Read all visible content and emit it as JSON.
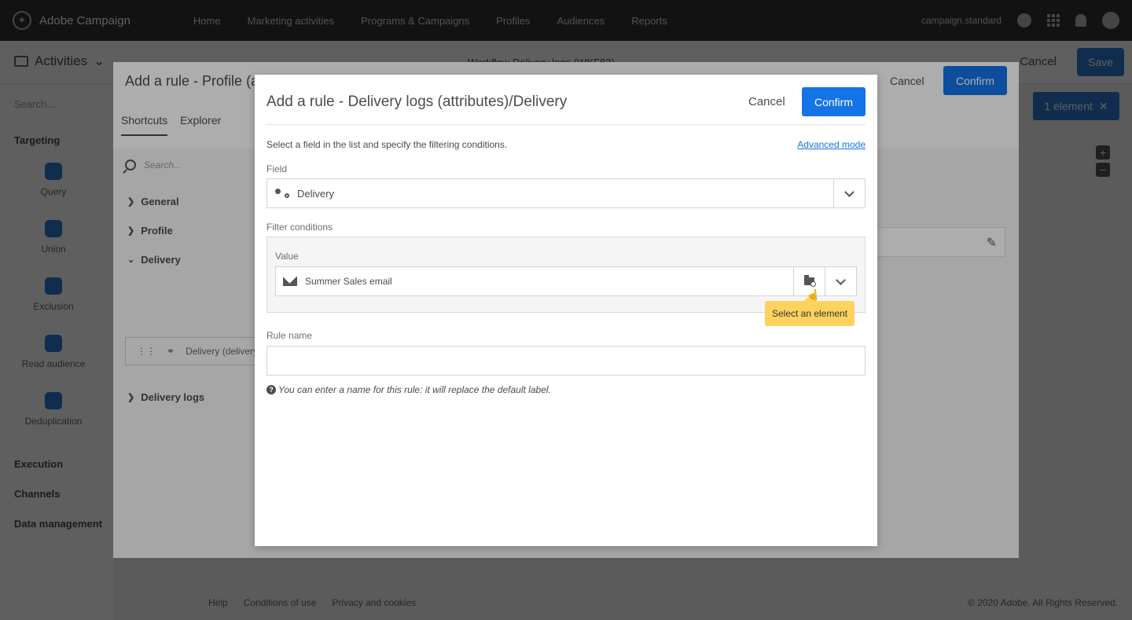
{
  "topbar": {
    "app_name": "Adobe Campaign",
    "nav": [
      "Home",
      "Marketing activities",
      "Programs & Campaigns",
      "Profiles",
      "Audiences",
      "Reports"
    ],
    "user": "campaign.standard"
  },
  "subbar": {
    "activities_label": "Activities",
    "workflow_title": "Workflow Delivery logs (WKF83)",
    "cancel_label": "Cancel",
    "save_label": "Save"
  },
  "leftpanel": {
    "search_placeholder": "Search...",
    "targeting": "Targeting",
    "items": [
      "Query",
      "Union",
      "Exclusion",
      "Read audience",
      "Deduplication"
    ],
    "execution": "Execution",
    "channels": "Channels",
    "data_management": "Data management"
  },
  "canvas": {
    "element_label": "1 element"
  },
  "footer": {
    "links": [
      "Help",
      "Conditions of use",
      "Privacy and cookies"
    ],
    "copyright": "© 2020 Adobe. All Rights Reserved."
  },
  "modal1": {
    "title": "Add a rule - Profile (attributes)",
    "cancel_label": "Cancel",
    "confirm_label": "Confirm",
    "tabs": [
      "Shortcuts",
      "Explorer"
    ],
    "search_placeholder": "Search...",
    "tree": [
      "General",
      "Profile",
      "Delivery",
      "Delivery logs"
    ],
    "leaf_label": "Delivery (delivery)"
  },
  "modal2": {
    "title": "Add a rule - Delivery logs (attributes)/Delivery",
    "cancel_label": "Cancel",
    "confirm_label": "Confirm",
    "hint": "Select a field in the list and specify the filtering conditions.",
    "advanced_mode": "Advanced mode",
    "field_label": "Field",
    "field_value": "Delivery",
    "filter_label": "Filter conditions",
    "value_label": "Value",
    "value_value": "Summer Sales email",
    "tooltip": "Select an element",
    "rule_name_label": "Rule name",
    "rule_name_value": "",
    "rule_hint": "You can enter a name for this rule: it will replace the default label."
  },
  "colors": {
    "primary_blue": "#1473e6",
    "tooltip_yellow": "#fdd35e",
    "topbar_dark": "#323232"
  }
}
